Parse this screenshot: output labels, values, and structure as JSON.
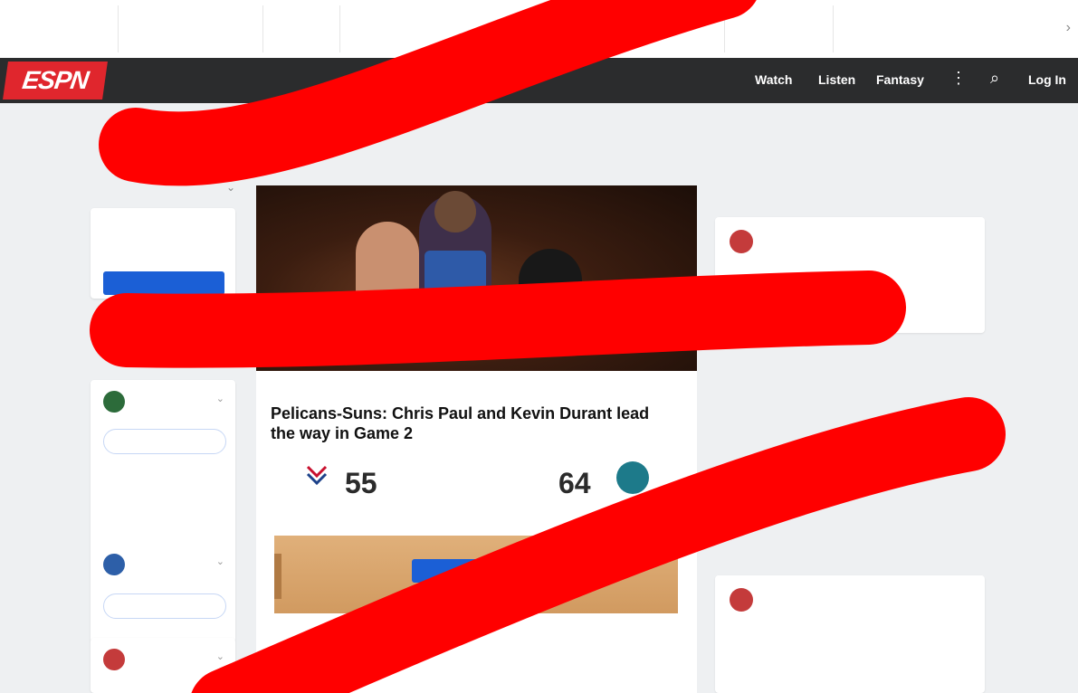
{
  "scores_strip": {
    "label": "",
    "tiles": [
      {
        "league": "",
        "status": "",
        "team1": "",
        "team2": ""
      },
      {
        "league": "",
        "status": "",
        "team1": "",
        "team2": ""
      },
      {
        "league": "",
        "status": "",
        "team1": "",
        "team2": ""
      },
      {
        "league": "",
        "status": "",
        "team1": "",
        "team2": ""
      },
      {
        "league": "",
        "status": "",
        "team1": "",
        "team2": ""
      }
    ]
  },
  "nav": {
    "logo_text": "ESPN",
    "items": [
      "",
      "",
      ""
    ],
    "right_items": [
      "Watch",
      "Listen",
      "Fantasy"
    ],
    "login_label": "Log In",
    "accent_color": "#e0262d"
  },
  "left_col": {
    "heading": "",
    "signin": {
      "message": "",
      "button_label": ""
    },
    "teams": [
      {
        "abbr": "",
        "follow_label": "",
        "blurb": "",
        "crest_color": "#2c6b3a"
      },
      {
        "abbr": "",
        "follow_label": "",
        "blurb": "",
        "crest_color": "#2d5fa8"
      },
      {
        "abbr": "",
        "follow_label": "",
        "blurb": "",
        "crest_color": "#c43b3b"
      }
    ]
  },
  "story": {
    "kicker": "",
    "headline": "Pelicans-Suns: Chris Paul and Kevin Durant lead the way in Game 2",
    "team_a_score": "55",
    "team_a_abbr": "",
    "mid_text": "",
    "team_b_score": "64",
    "cta_label": "",
    "more_text": "",
    "more_text_2": ""
  },
  "right_col": {
    "heading": "",
    "cards": [
      {
        "name": "",
        "handle": "",
        "text": "",
        "link": ""
      },
      {
        "name": "",
        "handle": "",
        "text": "",
        "link": ""
      }
    ]
  }
}
